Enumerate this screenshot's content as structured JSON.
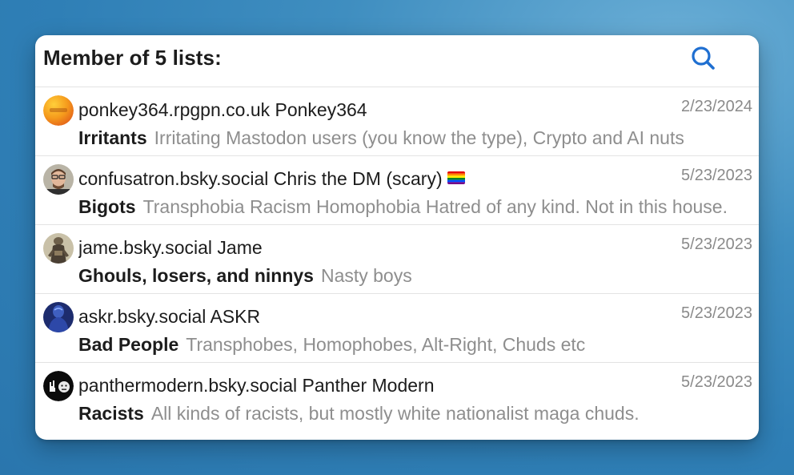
{
  "colors": {
    "accent": "#1f6fd1",
    "background": "#3a88bd",
    "card": "#ffffff",
    "muted_text": "#8e8e8e"
  },
  "header": {
    "title": "Member of 5 lists:",
    "search_icon": "search-icon"
  },
  "rows": [
    {
      "user": "ponkey364.rpgpn.co.uk Ponkey364",
      "date": "2/23/2024",
      "list_name": "Irritants",
      "list_desc": "Irritating Mastodon users (you know the type), Crypto and AI nuts",
      "avatar_icon": "orange-gradient-avatar"
    },
    {
      "user": "confusatron.bsky.social Chris the DM (scary)",
      "flag_icon": "rainbow-flag-icon",
      "date": "5/23/2023",
      "list_name": "Bigots",
      "list_desc": "Transphobia Racism Homophobia Hatred of any kind. Not in this house.",
      "avatar_icon": "person-photo-avatar"
    },
    {
      "user": "jame.bsky.social Jame",
      "date": "5/23/2023",
      "list_name": "Ghouls, losers, and ninnys",
      "list_desc": "Nasty boys",
      "avatar_icon": "figurine-avatar"
    },
    {
      "user": "askr.bsky.social ASKR",
      "date": "5/23/2023",
      "list_name": "Bad People",
      "list_desc": "Transphobes, Homophobes, Alt-Right, Chuds etc",
      "avatar_icon": "blue-figure-avatar"
    },
    {
      "user": "panthermodern.bsky.social Panther Modern",
      "date": "5/23/2023",
      "list_name": "Racists",
      "list_desc": "All kinds of racists, but mostly white nationalist maga chuds.",
      "avatar_icon": "rock-hand-smiley-avatar"
    }
  ]
}
